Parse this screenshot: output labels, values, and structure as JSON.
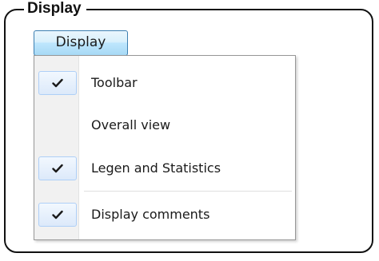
{
  "group": {
    "title": "Display"
  },
  "menubar": {
    "display_label": "Display"
  },
  "menu": {
    "items": [
      {
        "label": "Toolbar",
        "checked": true
      },
      {
        "label": "Overall view",
        "checked": false
      },
      {
        "label": "Legen and Statistics",
        "checked": true
      },
      {
        "label": "Display comments",
        "checked": true
      }
    ]
  },
  "colors": {
    "check_mark": "#1a1a1a",
    "highlight_border": "#3c7fb1"
  },
  "icons": {
    "check": "checkmark-icon"
  }
}
